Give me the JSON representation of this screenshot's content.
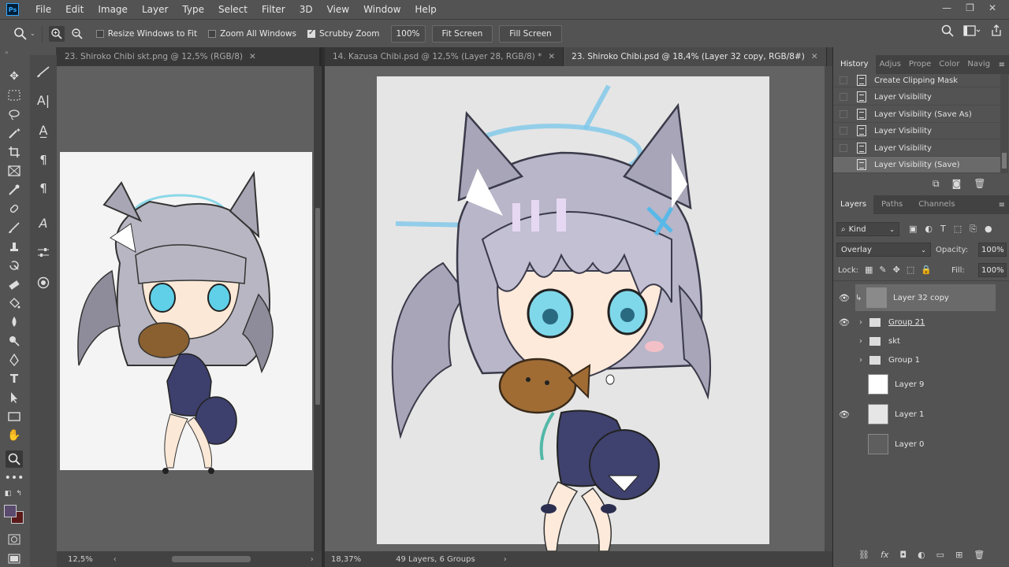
{
  "app": {
    "logo": "Ps"
  },
  "menu": [
    "File",
    "Edit",
    "Image",
    "Layer",
    "Type",
    "Select",
    "Filter",
    "3D",
    "View",
    "Window",
    "Help"
  ],
  "window_controls": [
    "—",
    "❐",
    "✕"
  ],
  "options": {
    "resize_windows": "Resize Windows to Fit",
    "zoom_all": "Zoom All Windows",
    "scrubby_zoom": "Scrubby Zoom",
    "zoom_value": "100%",
    "fit_screen": "Fit Screen",
    "fill_screen": "Fill Screen"
  },
  "docs": {
    "left": {
      "tab": "23. Shiroko Chibi skt.png @ 12,5% (RGB/8)",
      "zoom": "12,5%"
    },
    "main_tabs": [
      {
        "label": "14. Kazusa Chibi.psd @ 12,5% (Layer 28, RGB/8) *"
      },
      {
        "label": "23. Shiroko Chibi.psd @ 18,4% (Layer 32 copy, RGB/8#)"
      }
    ],
    "main_status": {
      "zoom": "18,37%",
      "info": "49 Layers, 6 Groups"
    }
  },
  "history": {
    "tabs": [
      "History",
      "Adjus",
      "Prope",
      "Color",
      "Navig"
    ],
    "items": [
      "Create Clipping Mask",
      "Layer Visibility",
      "Layer Visibility (Save As)",
      "Layer Visibility",
      "Layer Visibility",
      "Layer Visibility (Save)"
    ]
  },
  "layers_panel": {
    "tabs": [
      "Layers",
      "Paths",
      "Channels"
    ],
    "kind": "Kind",
    "blend_mode": "Overlay",
    "opacity_label": "Opacity:",
    "opacity": "100%",
    "lock_label": "Lock:",
    "fill_label": "Fill:",
    "fill": "100%",
    "layers": [
      {
        "name": "Layer 32 copy",
        "type": "layer",
        "visible": true
      },
      {
        "name": "Group 21",
        "type": "group",
        "visible": true
      },
      {
        "name": "skt",
        "type": "group",
        "visible": false
      },
      {
        "name": "Group 1",
        "type": "group",
        "visible": false
      },
      {
        "name": "Layer 9",
        "type": "layer",
        "visible": false
      },
      {
        "name": "Layer 1",
        "type": "layer",
        "visible": true
      },
      {
        "name": "Layer 0",
        "type": "layer",
        "visible": false
      }
    ]
  },
  "colors": {
    "foreground": "#5a4a6e",
    "background": "#5a1a1a"
  }
}
